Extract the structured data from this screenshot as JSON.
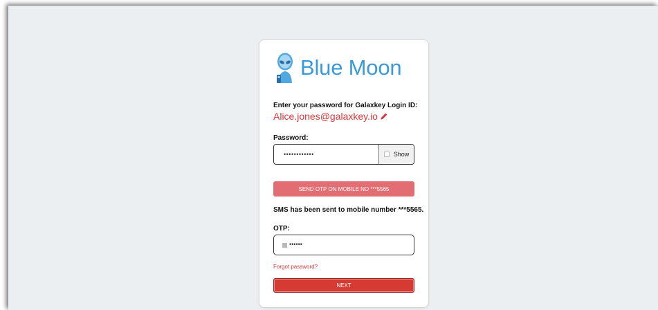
{
  "brand": {
    "name": "Blue Moon",
    "color": "#3a9ad9"
  },
  "login": {
    "prompt": "Enter your password for Galaxkey Login ID:",
    "login_id": "Alice.jones@galaxkey.io",
    "edit_icon": "pencil-icon"
  },
  "password": {
    "label": "Password:",
    "value": "••••••••••••",
    "show_label": "Show"
  },
  "otp_send": {
    "button_label": "SEND OTP ON MOBILE NO ***5565",
    "status_message": "SMS has been sent to mobile number ***5565."
  },
  "otp": {
    "label": "OTP:",
    "value": "••••••"
  },
  "links": {
    "forgot_password": "Forgot password?"
  },
  "actions": {
    "next_label": "NEXT"
  },
  "colors": {
    "accent_red": "#d9383a",
    "otp_button": "#e26d72",
    "next_button": "#d53b32",
    "background": "#eceff2"
  }
}
